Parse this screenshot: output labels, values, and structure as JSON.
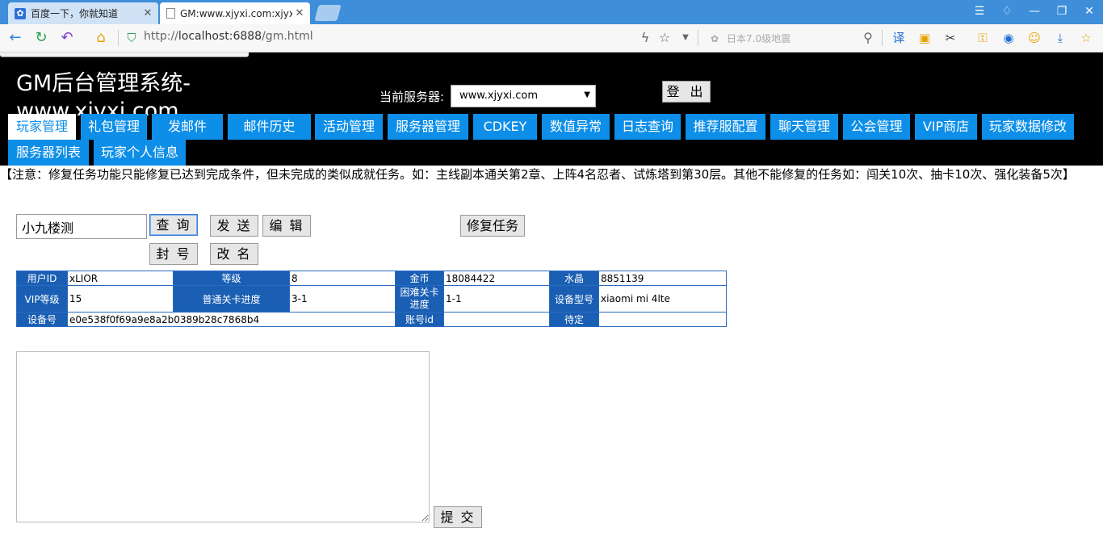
{
  "browser": {
    "tabs": [
      {
        "title": "百度一下，你就知道",
        "icon": "baidu-paw-icon",
        "active": false
      },
      {
        "title": "GM:www.xjyxi.com:xjyx",
        "icon": "page-icon",
        "active": true
      }
    ],
    "address": {
      "prefix": "http://",
      "host": "localhost:6888",
      "path": "/gm.html"
    },
    "search_placeholder": "日本7.0级地震"
  },
  "header": {
    "site_title": "GM后台管理系统-www.xjyxi.com",
    "server_label": "当前服务器:",
    "server_value": "www.xjyxi.com",
    "logout_label": "登 出"
  },
  "nav": {
    "tabs": [
      {
        "label": "玩家管理",
        "selected": true
      },
      {
        "label": "礼包管理"
      },
      {
        "label": "发邮件"
      },
      {
        "label": "邮件历史"
      },
      {
        "label": "活动管理"
      },
      {
        "label": "服务器管理"
      },
      {
        "label": "CDKEY"
      },
      {
        "label": "数值异常"
      },
      {
        "label": "日志查询"
      },
      {
        "label": "推荐服配置"
      },
      {
        "label": "聊天管理"
      },
      {
        "label": "公会管理"
      },
      {
        "label": "VIP商店"
      },
      {
        "label": "玩家数据修改"
      },
      {
        "label": "服务器列表"
      },
      {
        "label": "玩家个人信息"
      }
    ]
  },
  "notice": "【注意：修复任务功能只能修复已达到完成条件，但未完成的类似成就任务。如：主线副本通关第2章、上阵4名忍者、试炼塔到第30层。其他不能修复的任务如：闯关10次、抽卡10次、强化装备5次】",
  "player": {
    "search_value": "小九楼测",
    "buttons": {
      "query": "查 询",
      "send": "发 送",
      "edit": "编 辑",
      "fix_task": "修复任务",
      "ban": "封 号",
      "rename": "改 名"
    }
  },
  "info_table": {
    "rows": [
      [
        {
          "k": "用户ID",
          "v": "xLIOR"
        },
        {
          "k": "等级",
          "v": "8"
        },
        {
          "k": "金币",
          "v": "18084422"
        },
        {
          "k": "水晶",
          "v": "8851139"
        }
      ],
      [
        {
          "k": "VIP等级",
          "v": "15"
        },
        {
          "k": "普通关卡进度",
          "v": "3-1"
        },
        {
          "k": "困难关卡进度",
          "v": "1-1"
        },
        {
          "k": "设备型号",
          "v": "xiaomi mi 4lte"
        }
      ],
      [
        {
          "k": "设备号",
          "v": "e0e538f0f69a9e8a2b0389b28c7868b4"
        },
        {
          "k": "账号id",
          "v": ""
        },
        {
          "k": "待定",
          "v": ""
        }
      ]
    ]
  },
  "submit_label": "提 交"
}
